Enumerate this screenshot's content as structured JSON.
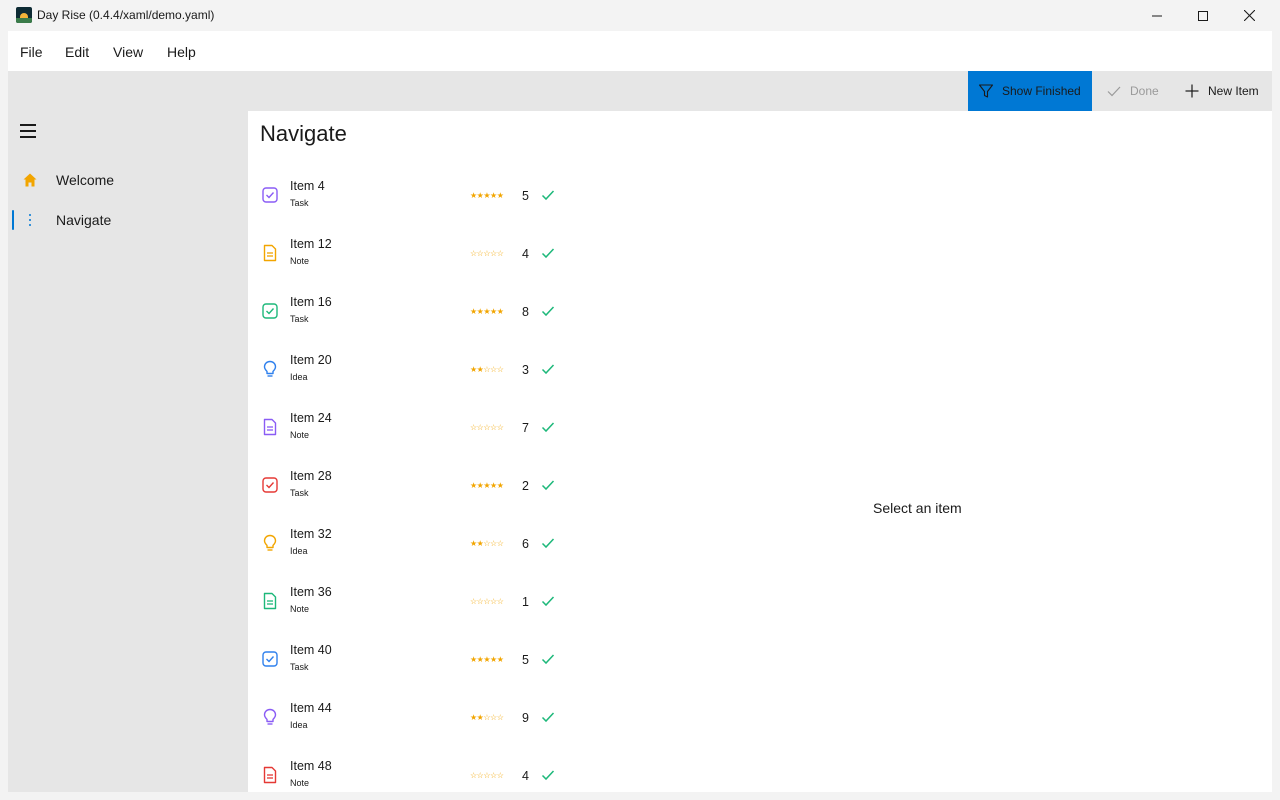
{
  "window": {
    "title": "Day Rise (0.4.4/xaml/demo.yaml)"
  },
  "menu": [
    "File",
    "Edit",
    "View",
    "Help"
  ],
  "commands": {
    "show_finished": "Show Finished",
    "done": "Done",
    "new_item": "New Item"
  },
  "sidebar": {
    "items": [
      {
        "label": "Welcome",
        "icon": "home-icon",
        "selected": false
      },
      {
        "label": "Navigate",
        "icon": "more-vertical-icon",
        "selected": true
      }
    ]
  },
  "main": {
    "title": "Navigate",
    "empty_message": "Select an item",
    "items": [
      {
        "name": "Item 4",
        "type": "Task",
        "icon": "task-icon",
        "color": "#8a5cf5",
        "stars": "★★★★★",
        "count": "5"
      },
      {
        "name": "Item 12",
        "type": "Note",
        "icon": "note-icon",
        "color": "#f2a500",
        "stars": "☆☆☆☆☆",
        "count": "4"
      },
      {
        "name": "Item 16",
        "type": "Task",
        "icon": "task-icon",
        "color": "#1db87a",
        "stars": "★★★★★",
        "count": "8"
      },
      {
        "name": "Item 20",
        "type": "Idea",
        "icon": "idea-icon",
        "color": "#2f80ed",
        "stars": "★★☆☆☆",
        "count": "3"
      },
      {
        "name": "Item 24",
        "type": "Note",
        "icon": "note-icon",
        "color": "#8a5cf5",
        "stars": "☆☆☆☆☆",
        "count": "7"
      },
      {
        "name": "Item 28",
        "type": "Task",
        "icon": "task-icon",
        "color": "#e53935",
        "stars": "★★★★★",
        "count": "2"
      },
      {
        "name": "Item 32",
        "type": "Idea",
        "icon": "idea-icon",
        "color": "#f2a500",
        "stars": "★★☆☆☆",
        "count": "6"
      },
      {
        "name": "Item 36",
        "type": "Note",
        "icon": "note-icon",
        "color": "#1db87a",
        "stars": "☆☆☆☆☆",
        "count": "1"
      },
      {
        "name": "Item 40",
        "type": "Task",
        "icon": "task-icon",
        "color": "#2f80ed",
        "stars": "★★★★★",
        "count": "5"
      },
      {
        "name": "Item 44",
        "type": "Idea",
        "icon": "idea-icon",
        "color": "#8a5cf5",
        "stars": "★★☆☆☆",
        "count": "9"
      },
      {
        "name": "Item 48",
        "type": "Note",
        "icon": "note-icon",
        "color": "#e53935",
        "stars": "☆☆☆☆☆",
        "count": "4"
      }
    ]
  },
  "colors": {
    "accent": "#0078d4",
    "check": "#1db87a",
    "star": "#f2a500",
    "home": "#f2a500"
  }
}
